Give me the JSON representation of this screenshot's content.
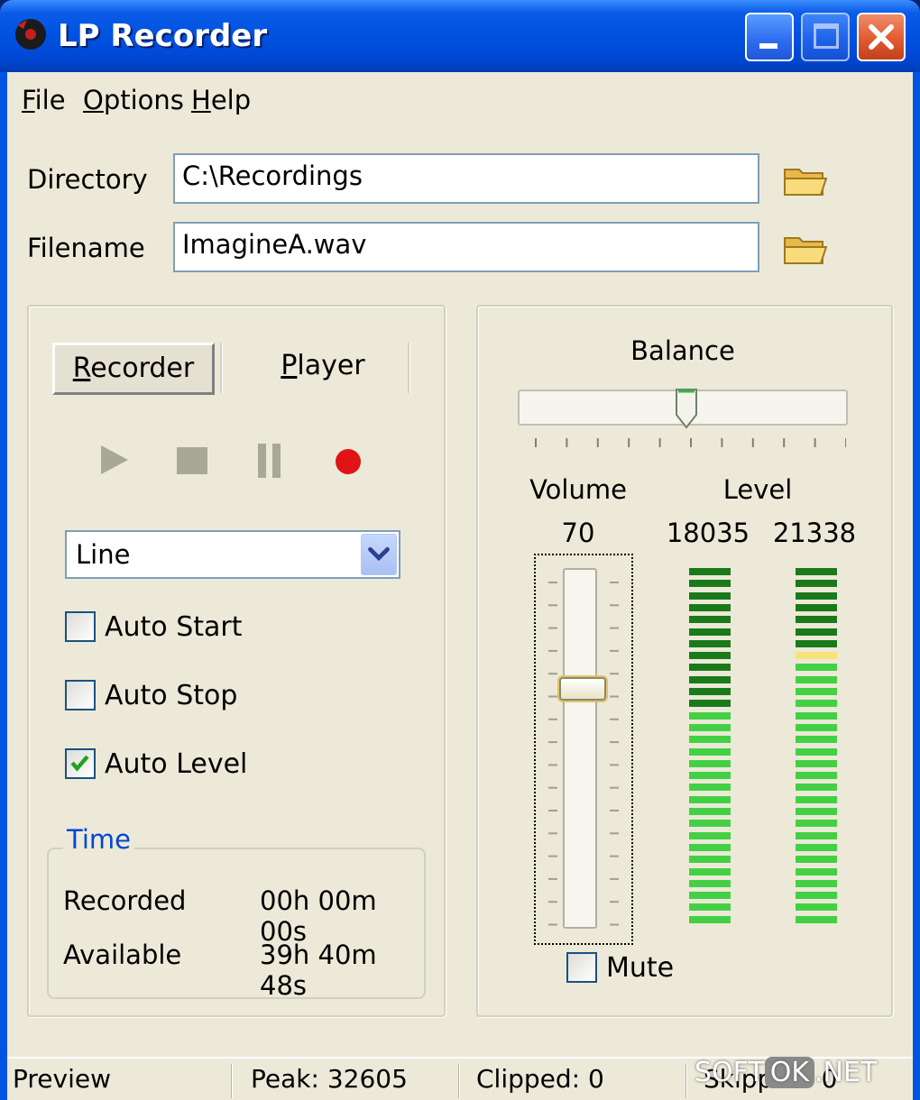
{
  "window": {
    "title": "LP Recorder",
    "buttons": {
      "minimize": "minimize",
      "maximize": "maximize",
      "close": "close"
    }
  },
  "menu": {
    "items": [
      {
        "label": "File",
        "accel": "F",
        "rest": "ile"
      },
      {
        "label": "Options",
        "accel": "O",
        "rest": "ptions"
      },
      {
        "label": "Help",
        "accel": "H",
        "rest": "elp"
      }
    ]
  },
  "fields": {
    "directory_label": "Directory",
    "directory_value": "C:\\Recordings",
    "filename_label": "Filename",
    "filename_value": "ImagineA.wav"
  },
  "tabs": [
    {
      "label": "Recorder",
      "accel": "R",
      "rest": "ecorder",
      "active": true
    },
    {
      "label": "Player",
      "accel": "P",
      "rest": "layer",
      "active": false
    }
  ],
  "transport": {
    "icons": [
      "play-icon",
      "stop-icon",
      "pause-icon",
      "record-icon"
    ]
  },
  "source": {
    "selected": "Line"
  },
  "options": {
    "auto_start": {
      "label": "Auto Start",
      "checked": false
    },
    "auto_stop": {
      "label": "Auto Stop",
      "checked": false
    },
    "auto_level": {
      "label": "Auto Level",
      "checked": true
    }
  },
  "time": {
    "legend": "Time",
    "recorded_label": "Recorded",
    "recorded_value": "00h 00m 00s",
    "available_label": "Available",
    "available_value": "39h 40m 48s"
  },
  "mixer": {
    "balance_label": "Balance",
    "balance_fraction": 0.5,
    "volume_label": "Volume",
    "volume_value": "70",
    "volume_fraction": 0.7,
    "level_label": "Level",
    "level_left": "18035",
    "level_right": "21338",
    "level_left_lit_bars": 30,
    "level_right_lit_bars": 30,
    "mute_label": "Mute",
    "mute_checked": false
  },
  "status": {
    "preview": "Preview",
    "peak": "Peak: 32605",
    "clipped": "Clipped: 0",
    "skipped": "Skipped: 0"
  },
  "watermark": {
    "left": "SOFT",
    "mid": "OK",
    "right": ".NET"
  },
  "colors": {
    "title_bar": "#0054e3",
    "face": "#ece9d8",
    "record": "#e01414",
    "meter_dark": "#1a7a1a",
    "meter_light": "#44d044",
    "meter_yellow": "#f6e27a",
    "legend_blue": "#0046d5"
  }
}
